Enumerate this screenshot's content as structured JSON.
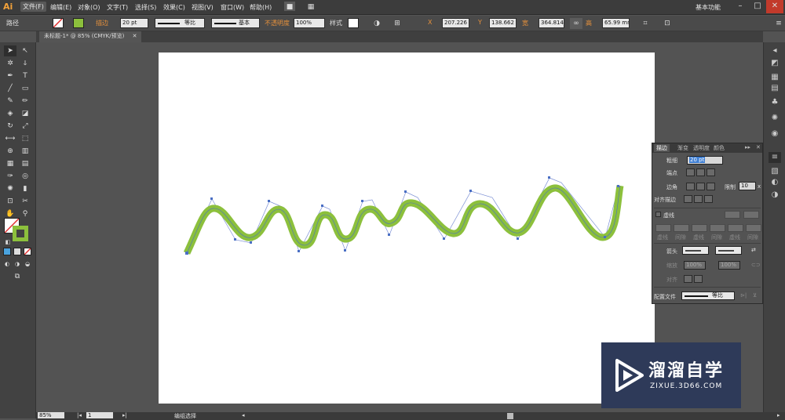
{
  "menubar": {
    "logo": "Ai",
    "items": [
      "文件(F)",
      "编辑(E)",
      "对象(O)",
      "文字(T)",
      "选择(S)",
      "效果(C)",
      "视图(V)",
      "窗口(W)",
      "帮助(H)"
    ],
    "workspace": "基本功能",
    "window_controls": [
      "–",
      "□",
      "✕"
    ]
  },
  "control_bar": {
    "object_type": "路径",
    "stroke_label": "描边",
    "stroke_weight": "20 pt",
    "profile": "等比",
    "brush": "基本",
    "opacity_label": "不透明度",
    "opacity_value": "100%",
    "style_label": "样式",
    "x_label": "X",
    "x_value": "207.226 r",
    "y_label": "Y",
    "y_value": "138.662 r",
    "w_label": "宽",
    "w_value": "364.814 r",
    "h_label": "高",
    "h_value": "65.99 mm",
    "stroke_color": "#8cc03c"
  },
  "document_tab": {
    "title": "未标题-1* @ 85% (CMYK/预览)"
  },
  "artwork": {
    "stroke_color": "#8cc03c",
    "anchor_color": "#4a6fc4"
  },
  "stroke_panel": {
    "tabs": [
      "描边",
      "渐变",
      "透明度",
      "颜色"
    ],
    "weight_label": "粗细",
    "weight_value": "20 pt",
    "cap_label": "端点",
    "corner_label": "边角",
    "limit_label": "限制",
    "limit_value": "10",
    "limit_unit": "x",
    "align_label": "对齐描边",
    "dashed_label": "虚线",
    "dash_labels": [
      "虚线",
      "间隙",
      "虚线",
      "间隙",
      "虚线",
      "间隙"
    ],
    "arrow_label": "箭头",
    "scale_label": "缩放",
    "scale_value_1": "100%",
    "scale_value_2": "100%",
    "align2_label": "对齐",
    "profile_label": "配置文件",
    "profile_value": "等比"
  },
  "status_bar": {
    "zoom": "85%",
    "page": "1",
    "tool": "编组选择"
  },
  "watermark": {
    "title": "溜溜自学",
    "subtitle": "ZIXUE.3D66.COM"
  }
}
